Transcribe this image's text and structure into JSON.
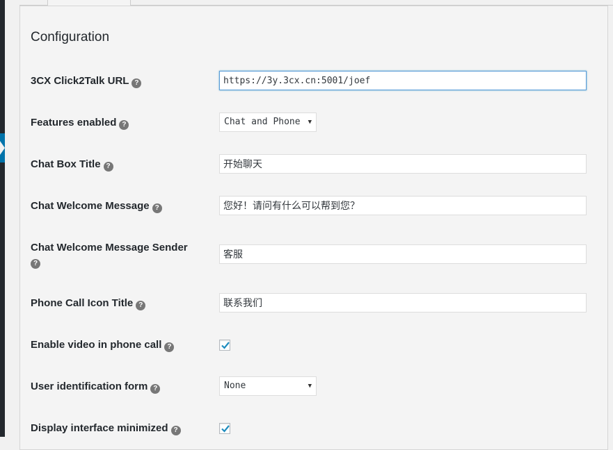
{
  "section": {
    "title": "Configuration"
  },
  "fields": {
    "url": {
      "label": "3CX Click2Talk URL",
      "value": "https://3y.3cx.cn:5001/joef"
    },
    "features": {
      "label": "Features enabled",
      "selected": "Chat and Phone"
    },
    "chat_title": {
      "label": "Chat Box Title",
      "value": "开始聊天"
    },
    "welcome_message": {
      "label": "Chat Welcome Message",
      "value": "您好！请问有什么可以帮到您？"
    },
    "welcome_sender": {
      "label": "Chat Welcome Message Sender",
      "value": "客服"
    },
    "phone_icon_title": {
      "label": "Phone Call Icon Title",
      "value": "联系我们"
    },
    "enable_video": {
      "label": "Enable video in phone call",
      "checked": true
    },
    "user_form": {
      "label": "User identification form",
      "selected": "None"
    },
    "minimized": {
      "label": "Display interface minimized",
      "checked": true
    }
  },
  "icons": {
    "help": "?",
    "caret": "▼"
  },
  "colors": {
    "accent": "#0073aa",
    "check": "#1e8cbe",
    "focus_border": "#5b9dd9"
  }
}
